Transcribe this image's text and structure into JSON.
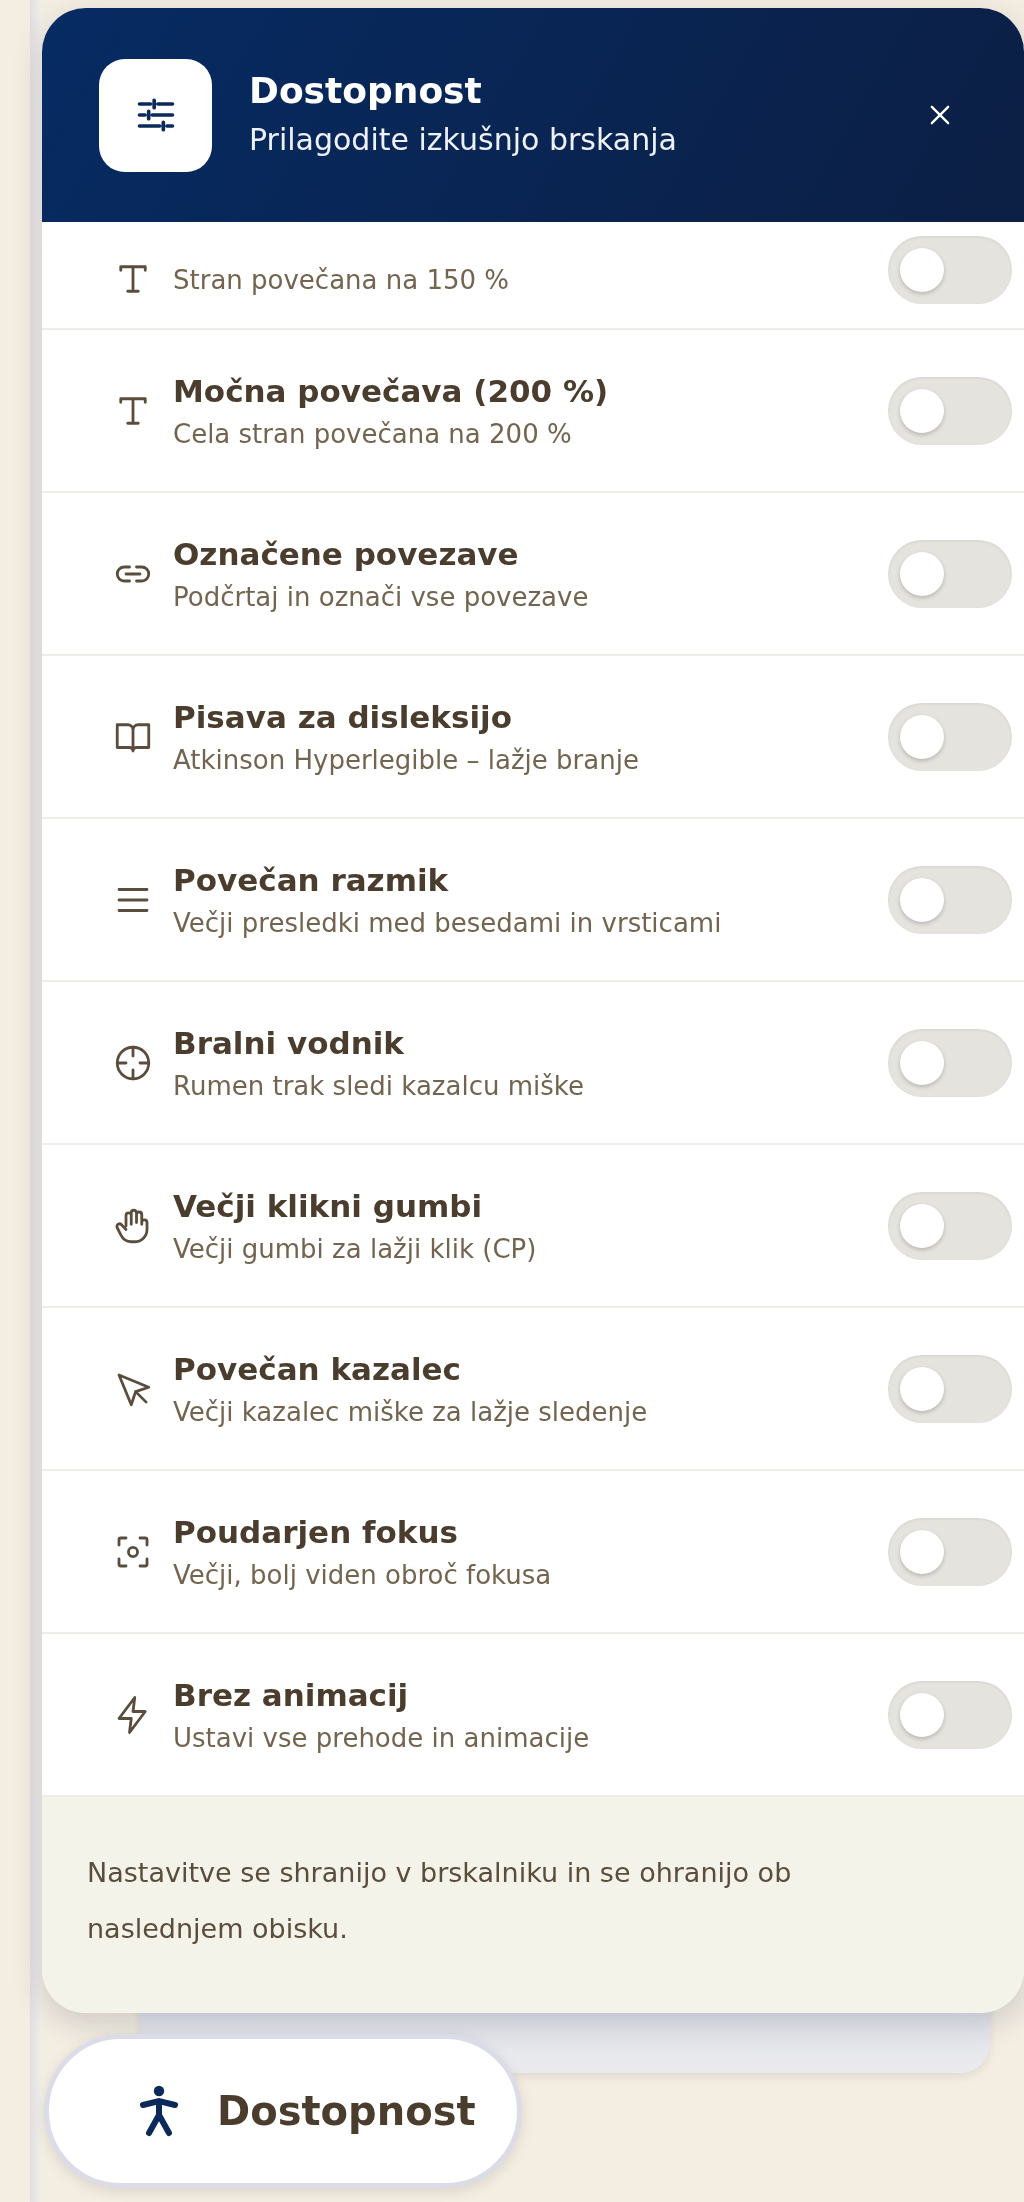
{
  "panel": {
    "title": "Dostopnost",
    "subtitle": "Prilagodite izkušnjo brskanja"
  },
  "options": [
    {
      "kind": "text",
      "description": "Stran povečana na 150 %",
      "on": false
    },
    {
      "kind": "text",
      "title": "Močna povečava (200 %)",
      "description": "Cela stran povečana na 200 %",
      "on": false
    },
    {
      "kind": "link",
      "title": "Označene povezave",
      "description": "Podčrtaj in označi vse povezave",
      "on": false
    },
    {
      "kind": "book",
      "title": "Pisava za disleksijo",
      "description": "Atkinson Hyperlegible – lažje branje",
      "on": false
    },
    {
      "kind": "lines",
      "title": "Povečan razmik",
      "description": "Večji presledki med besedami in vrsticami",
      "on": false
    },
    {
      "kind": "crosshair",
      "title": "Bralni vodnik",
      "description": "Rumen trak sledi kazalcu miške",
      "on": false
    },
    {
      "kind": "hand",
      "title": "Večji klikni gumbi",
      "description": "Večji gumbi za lažji klik (CP)",
      "on": false
    },
    {
      "kind": "cursor",
      "title": "Povečan kazalec",
      "description": "Večji kazalec miške za lažje sledenje",
      "on": false
    },
    {
      "kind": "focus",
      "title": "Poudarjen fokus",
      "description": "Večji, bolj viden obroč fokusa",
      "on": false
    },
    {
      "kind": "bolt",
      "title": "Brez animacij",
      "description": "Ustavi vse prehode in animacije",
      "on": false
    }
  ],
  "footer_note": "Nastavitve se shranijo v brskalniku in se ohranijo ob naslednjem obisku.",
  "launcher": {
    "label": "Dostopnost"
  }
}
